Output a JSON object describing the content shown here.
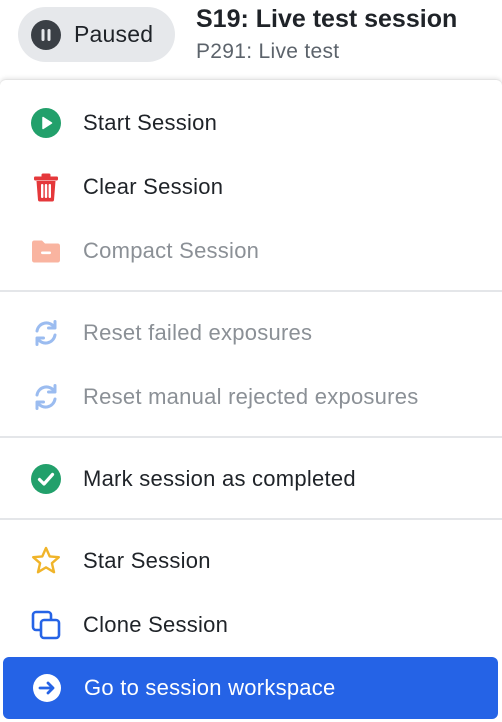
{
  "header": {
    "status_label": "Paused",
    "title": "S19: Live test session",
    "subtitle": "P291: Live test"
  },
  "menu": {
    "items": [
      {
        "label": "Start Session",
        "icon": "play-circle-icon",
        "color": "#22a06b",
        "enabled": true
      },
      {
        "label": "Clear Session",
        "icon": "trash-icon",
        "color": "#e5383b",
        "enabled": true
      },
      {
        "label": "Compact Session",
        "icon": "folder-minus-icon",
        "color": "#f9b4a0",
        "enabled": false
      },
      {
        "label": "Reset failed exposures",
        "icon": "refresh-icon",
        "color": "#9bbcf0",
        "enabled": false
      },
      {
        "label": "Reset manual rejected exposures",
        "icon": "refresh-icon",
        "color": "#9bbcf0",
        "enabled": false
      },
      {
        "label": "Mark session as completed",
        "icon": "check-circle-icon",
        "color": "#22a06b",
        "enabled": true
      },
      {
        "label": "Star Session",
        "icon": "star-icon",
        "color": "#f0b429",
        "enabled": true
      },
      {
        "label": "Clone Session",
        "icon": "clone-icon",
        "color": "#2563e6",
        "enabled": true
      },
      {
        "label": "Go to session workspace",
        "icon": "arrow-right-circle-icon",
        "color": "#ffffff",
        "enabled": true
      }
    ]
  },
  "colors": {
    "primary": "#2563e6",
    "text": "#1f2328",
    "muted_text": "#8b9096",
    "pill_bg": "#e6e8eb"
  }
}
